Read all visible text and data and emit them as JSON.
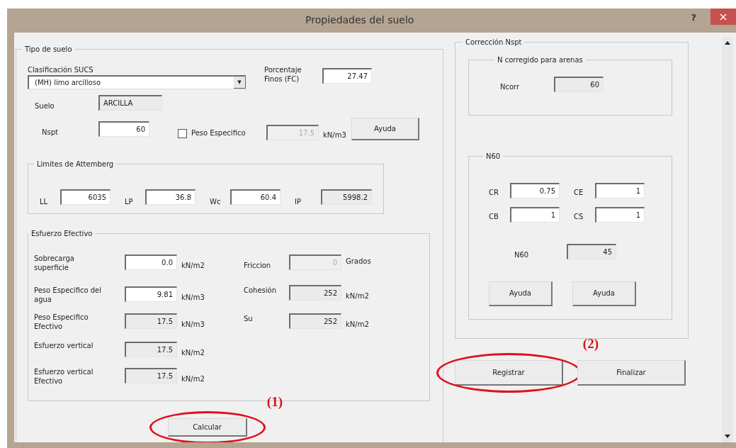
{
  "window": {
    "title": "Propiedades del suelo",
    "help": "?",
    "close": "×"
  },
  "tipo_de_suelo": {
    "title": "Tipo de suelo",
    "clasificacion": {
      "label": "Clasificación SUCS",
      "value": "(MH) limo arcilloso",
      "arrow": "▼"
    },
    "porcentaje_finos": {
      "label": "Porcentaje Finos (FC)",
      "value": "27.47",
      "kind": "input"
    },
    "suelo": {
      "label": "Suelo",
      "value": "ARCILLA",
      "kind": "output"
    },
    "nspt": {
      "label": "Nspt",
      "value": "60",
      "kind": "input"
    },
    "peso_especifico": {
      "label": "Peso Especifico",
      "checked": false,
      "value": "17.5",
      "kind": "disabled",
      "unit": "kN/m3"
    },
    "help_button": "Ayuda",
    "attemberg": {
      "title": "Limites de Attemberg",
      "fields": [
        {
          "label": "LL",
          "value": "6035",
          "kind": "input"
        },
        {
          "label": "LP",
          "value": "36.8",
          "kind": "input"
        },
        {
          "label": "Wc",
          "value": "60.4",
          "kind": "input"
        },
        {
          "label": "IP",
          "value": "5998.2",
          "kind": "output"
        }
      ]
    },
    "esfuerzo_efectivo": {
      "title": "Esfuerzo Efectivo",
      "left": [
        {
          "label": "Sobrecarga superficie",
          "value": "0.0",
          "kind": "input",
          "unit": "kN/m2"
        },
        {
          "label": "Peso Especifico del agua",
          "value": "9.81",
          "kind": "input",
          "unit": "kN/m3"
        },
        {
          "label": "Peso Especifico Efectivo",
          "value": "17.5",
          "kind": "output",
          "unit": "kN/m3"
        },
        {
          "label": "Esfuerzo vertical",
          "value": "17.5",
          "kind": "output",
          "unit": "kN/m2"
        },
        {
          "label": "Esfuerzo vertical Efectivo",
          "value": "17.5",
          "kind": "output",
          "unit": "kN/m2"
        }
      ],
      "right": [
        {
          "label": "Friccion",
          "value": "0",
          "kind": "disabled",
          "unit": "Grados"
        },
        {
          "label": "Cohesión",
          "value": "252",
          "kind": "output",
          "unit": "kN/m2"
        },
        {
          "label": "Su",
          "value": "252",
          "kind": "output",
          "unit": "kN/m2"
        }
      ]
    },
    "calcular": {
      "label": "Calcular",
      "annotation": "(1)"
    }
  },
  "correccion_nspt": {
    "title": "Corrección Nspt",
    "n_corregido": {
      "title": "N corregido para arenas",
      "label": "Ncorr",
      "value": "60",
      "kind": "output"
    },
    "n60": {
      "title": "N60",
      "factors": [
        {
          "label": "CR",
          "value": "0.75",
          "kind": "input"
        },
        {
          "label": "CE",
          "value": "1",
          "kind": "input"
        },
        {
          "label": "CB",
          "value": "1",
          "kind": "input"
        },
        {
          "label": "CS",
          "value": "1",
          "kind": "input"
        }
      ],
      "result": {
        "label": "N60",
        "value": "45",
        "kind": "output"
      },
      "help_buttons": [
        "Ayuda",
        "Ayuda"
      ]
    }
  },
  "actions": [
    {
      "label": "Registrar",
      "annotation": "(2)"
    },
    {
      "label": "Finalizar"
    }
  ]
}
